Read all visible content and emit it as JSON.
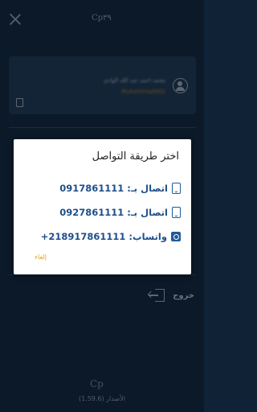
{
  "topbar": {
    "logo_text": "Cp٣٩"
  },
  "profile": {
    "name": "محمد احمد عبد الله الوادي",
    "subtitle": "Muhammad002"
  },
  "logout": {
    "label": "خروج"
  },
  "footer": {
    "logo_text": "Cp",
    "version": "الأصدار (1.59.6)"
  },
  "dialog": {
    "title": "اختر طريقة التواصل",
    "options": [
      {
        "label": "اتصال بـ: 0917861111",
        "icon": "phone-icon"
      },
      {
        "label": "اتصال بـ: 0927861111",
        "icon": "phone-icon"
      },
      {
        "label": "واتساب: 218917861111+",
        "icon": "whatsapp-icon"
      }
    ],
    "cancel_label": "إلغاء"
  },
  "colors": {
    "background": "#0f2236",
    "card": "#1a3148",
    "accent_blue": "#1f4f8a",
    "cancel_orange": "#e3a022"
  }
}
